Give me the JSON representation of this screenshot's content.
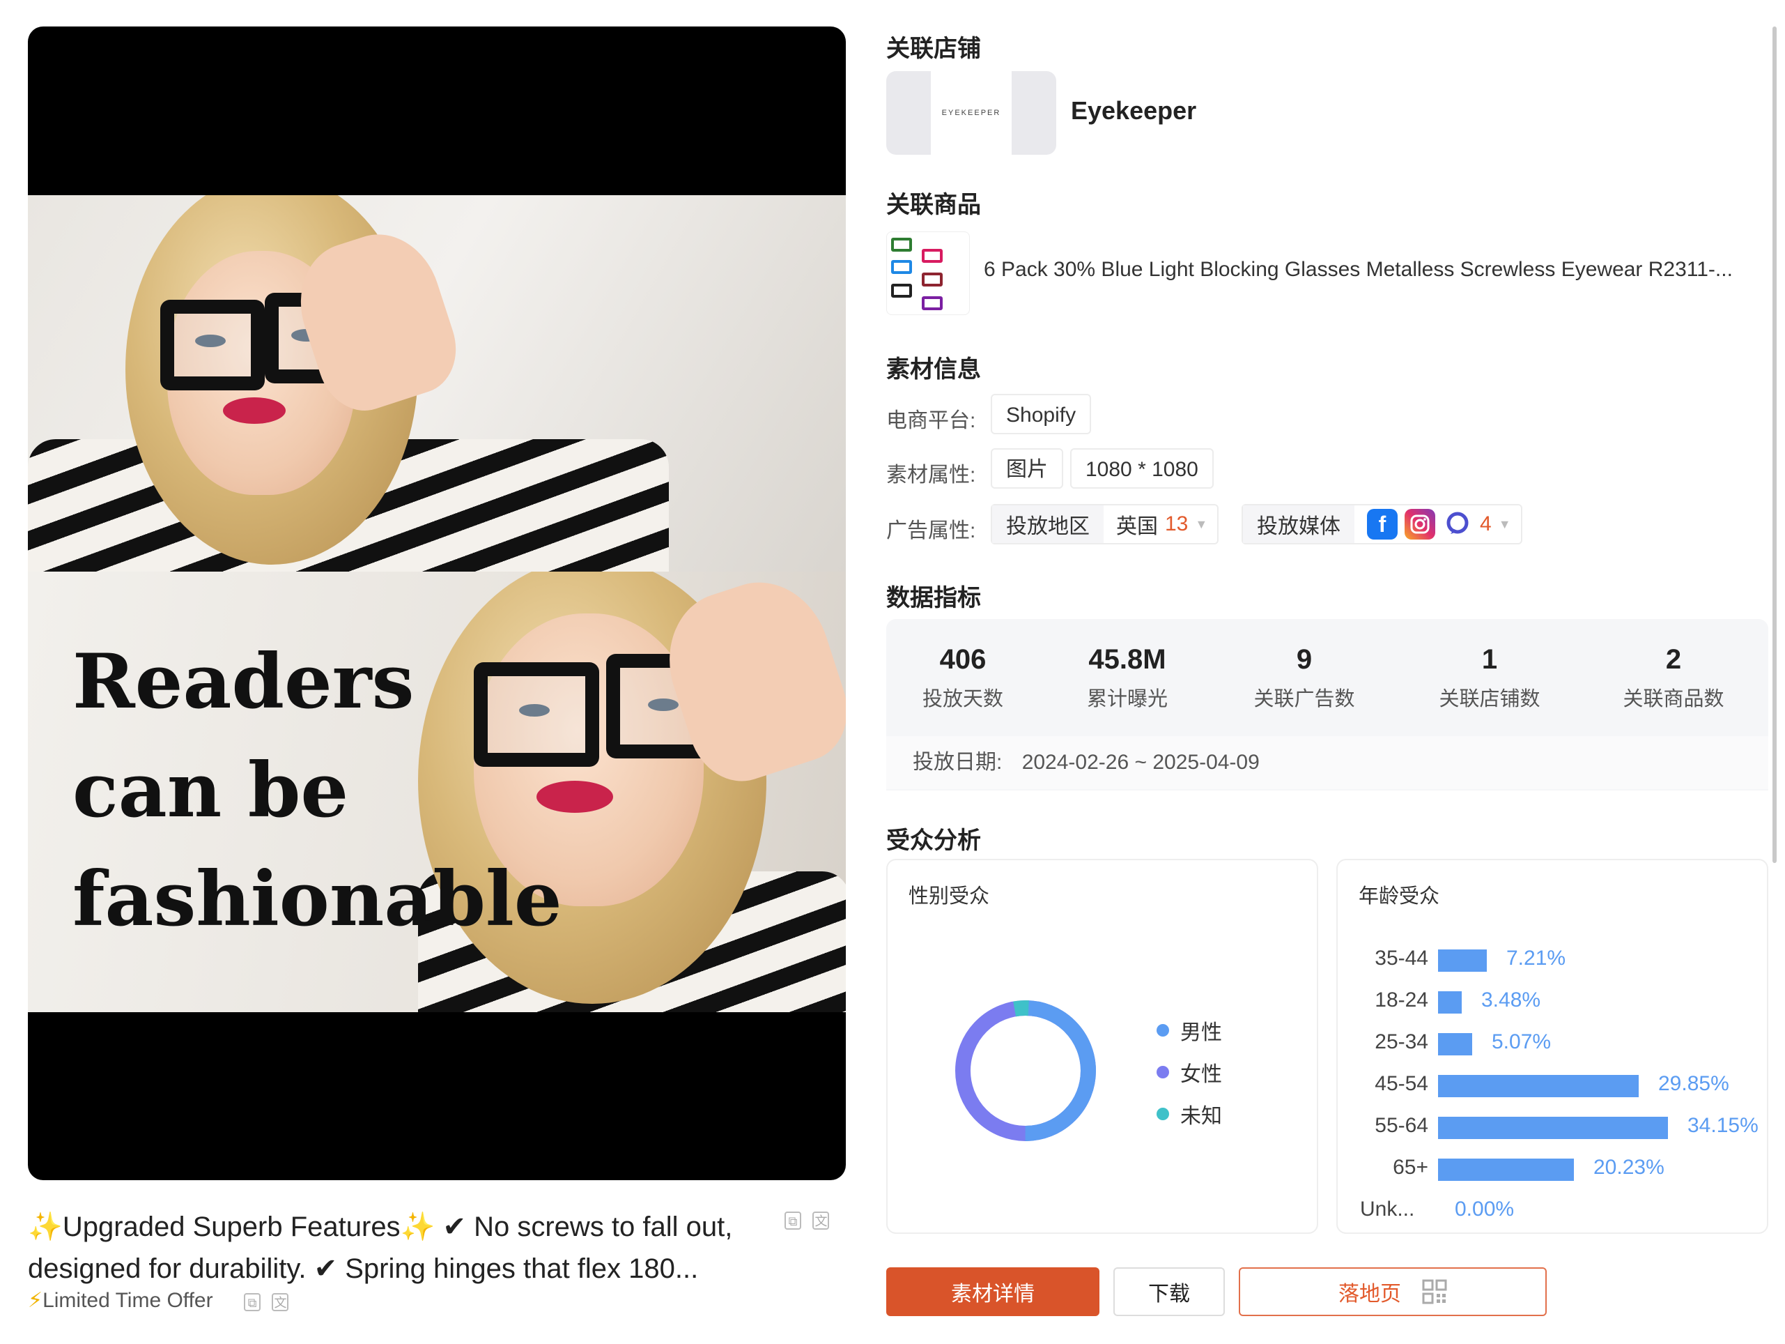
{
  "creative": {
    "overlay_lines": [
      "Readers",
      "can be",
      "fashionable"
    ]
  },
  "caption": {
    "spark_1": "✨",
    "text_a": "Upgraded Superb Features",
    "spark_2": "✨",
    "text_b": " ✔ No screws to fall out, designed for durability. ✔ Spring hinges that flex 180...",
    "offer_icon": "⚡",
    "offer_text": "Limited Time Offer"
  },
  "store": {
    "title": "关联店铺",
    "logo_text": "EYEKEEPER",
    "name": "Eyekeeper"
  },
  "product": {
    "title": "关联商品",
    "name": "6 Pack 30% Blue Light Blocking Glasses Metalless Screwless Eyewear R2311-..."
  },
  "material": {
    "title": "素材信息",
    "platform_label": "电商平台:",
    "platform_value": "Shopify",
    "attr_label": "素材属性:",
    "attr_type": "图片",
    "attr_size": "1080 * 1080",
    "ad_label": "广告属性:",
    "region_label": "投放地区",
    "region_value": "英国",
    "region_count": "13",
    "media_label": "投放媒体",
    "media_count": "4",
    "media_icons": [
      "facebook-icon",
      "instagram-icon",
      "messenger-icon"
    ]
  },
  "metrics": {
    "title": "数据指标",
    "items": [
      {
        "value": "406",
        "label": "投放天数"
      },
      {
        "value": "45.8M",
        "label": "累计曝光"
      },
      {
        "value": "9",
        "label": "关联广告数"
      },
      {
        "value": "1",
        "label": "关联店铺数"
      },
      {
        "value": "2",
        "label": "关联商品数"
      }
    ],
    "date_label": "投放日期:",
    "date_range": "2024-02-26 ~ 2025-04-09"
  },
  "audience": {
    "title": "受众分析",
    "gender": {
      "title": "性别受众",
      "legend": [
        {
          "label": "男性",
          "color": "#5b9cf2"
        },
        {
          "label": "女性",
          "color": "#7b7cf0"
        },
        {
          "label": "未知",
          "color": "#3fc1c9"
        }
      ]
    },
    "age": {
      "title": "年龄受众",
      "rows": [
        {
          "label": "35-44",
          "value": "7.21%",
          "pct": 7.21
        },
        {
          "label": "18-24",
          "value": "3.48%",
          "pct": 3.48
        },
        {
          "label": "25-34",
          "value": "5.07%",
          "pct": 5.07
        },
        {
          "label": "45-54",
          "value": "29.85%",
          "pct": 29.85
        },
        {
          "label": "55-64",
          "value": "34.15%",
          "pct": 34.15
        },
        {
          "label": "65+",
          "value": "20.23%",
          "pct": 20.23
        },
        {
          "label": "Unk...",
          "value": "0.00%",
          "pct": 0
        }
      ],
      "bar_color": "#5b9cf2"
    }
  },
  "buttons": {
    "detail": "素材详情",
    "download": "下载",
    "landing": "落地页"
  },
  "colors": {
    "accent": "#d9542a",
    "chart_blue": "#5b9cf2"
  }
}
